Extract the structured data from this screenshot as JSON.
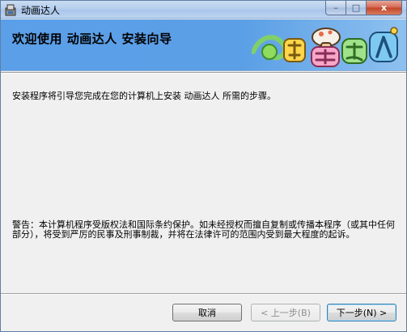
{
  "window": {
    "title": "动画达人",
    "caption_buttons": {
      "minimize": "–",
      "maximize": "□",
      "close": "x"
    }
  },
  "banner": {
    "title": "欢迎使用  动画达人  安装向导",
    "logo_text": "动画达人",
    "logo_icon": "colorful-cartoon-logo"
  },
  "content": {
    "intro": "安装程序将引导您完成在您的计算机上安装 动画达人 所需的步骤。",
    "warning": "警告：本计算机程序受版权法和国际条约保护。如未经授权而擅自复制或传播本程序（或其中任何部分），将受到严厉的民事及刑事制裁，并将在法律许可的范围内受到最大程度的起诉。"
  },
  "buttons": {
    "cancel": "取消",
    "back": "< 上一步(B)",
    "next": "下一步(N) >"
  },
  "colors": {
    "banner": "#5b9fe6",
    "window_bg": "#f0f0f0",
    "close_button": "#c34428"
  }
}
